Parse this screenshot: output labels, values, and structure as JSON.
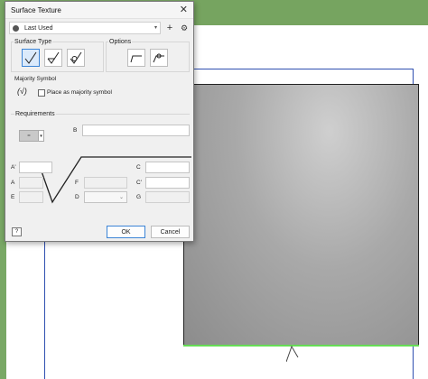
{
  "dialog": {
    "title": "Surface Texture",
    "close_glyph": "✕",
    "preset": {
      "value": "Last Used",
      "add_glyph": "+",
      "settings_glyph": "⚙"
    },
    "surface_type": {
      "label": "Surface Type",
      "options": [
        {
          "icon": "basic-surface-icon",
          "selected": true
        },
        {
          "icon": "material-removal-required-icon",
          "selected": false
        },
        {
          "icon": "material-removal-prohibited-icon",
          "selected": false
        }
      ]
    },
    "options_group": {
      "label": "Options",
      "buttons": [
        {
          "icon": "long-leg-icon"
        },
        {
          "icon": "all-around-icon"
        }
      ]
    },
    "majority": {
      "label": "Majority Symbol",
      "symbol": "(√)",
      "checkbox_label": "Place as majority symbol",
      "checked": false
    },
    "requirements": {
      "label": "Requirements",
      "fields": {
        "B": {
          "label": "B",
          "value": ""
        },
        "A_prime": {
          "label": "A'",
          "value": ""
        },
        "A": {
          "label": "A",
          "value": ""
        },
        "E": {
          "label": "E",
          "value": ""
        },
        "F": {
          "label": "F",
          "value": ""
        },
        "D": {
          "label": "D",
          "value": ""
        },
        "C": {
          "label": "C",
          "value": ""
        },
        "C_prime": {
          "label": "C'",
          "value": ""
        },
        "G": {
          "label": "G",
          "value": ""
        }
      },
      "lay_glyph": "=",
      "dropdown_glyph": "▾"
    },
    "help_glyph": "?",
    "ok_label": "OK",
    "cancel_label": "Cancel"
  },
  "colors": {
    "accent": "#3b84d6",
    "edge_highlight": "#66dd55",
    "sheet_border": "#2f4fb0"
  }
}
